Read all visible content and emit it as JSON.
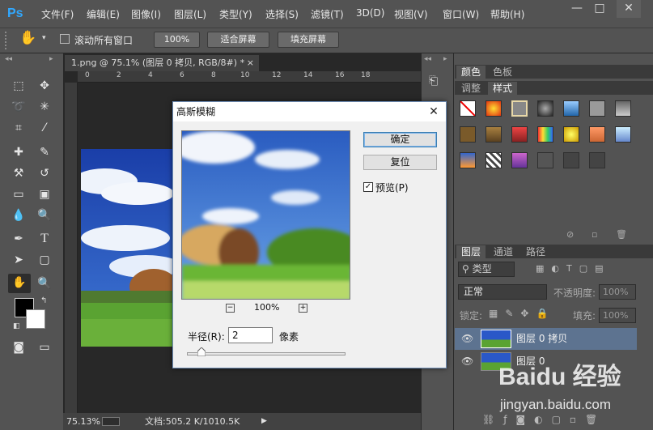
{
  "app": {
    "logo": "Ps"
  },
  "menu": [
    "文件(F)",
    "编辑(E)",
    "图像(I)",
    "图层(L)",
    "类型(Y)",
    "选择(S)",
    "滤镜(T)",
    "3D(D)",
    "视图(V)",
    "窗口(W)",
    "帮助(H)"
  ],
  "window_controls": {
    "minimize": "—",
    "maximize": "□",
    "close": "✕"
  },
  "options": {
    "scroll_all_label": "滚动所有窗口",
    "zoom_btn": "100%",
    "fit_screen": "适合屏幕",
    "fill_screen": "填充屏幕"
  },
  "document": {
    "tab_title": "1.png @ 75.1% (图层 0 拷贝, RGB/8#) *",
    "tab_close": "×",
    "ruler_ticks": [
      "0",
      "2",
      "4",
      "6",
      "8",
      "10",
      "12",
      "14",
      "16",
      "18"
    ]
  },
  "status": {
    "zoom": "75.13%",
    "info": "文档:505.2 K/1010.5K"
  },
  "panels": {
    "top_tabs": [
      "颜色",
      "色板"
    ],
    "mid_tabs": [
      "调整",
      "样式"
    ],
    "layers_tabs": [
      "图层",
      "通道",
      "路径"
    ],
    "filter_kind": "类型",
    "blend_mode": "正常",
    "opacity_label": "不透明度:",
    "opacity_value": "100%",
    "lock_label": "锁定:",
    "fill_label": "填充:",
    "fill_value": "100%"
  },
  "layers": [
    {
      "name": "图层 0 拷贝",
      "selected": true
    },
    {
      "name": "图层 0",
      "selected": false
    }
  ],
  "dialog": {
    "title": "高斯模糊",
    "close": "✕",
    "ok": "确定",
    "reset": "复位",
    "preview_label": "预览(P)",
    "preview_checked": true,
    "zoom": "100%",
    "radius_label": "半径(R):",
    "radius_value": "2",
    "radius_unit": "像素",
    "radius_slider_fraction": 0.09
  },
  "watermark": {
    "brand": "Baidu 经验",
    "url": "jingyan.baidu.com"
  }
}
